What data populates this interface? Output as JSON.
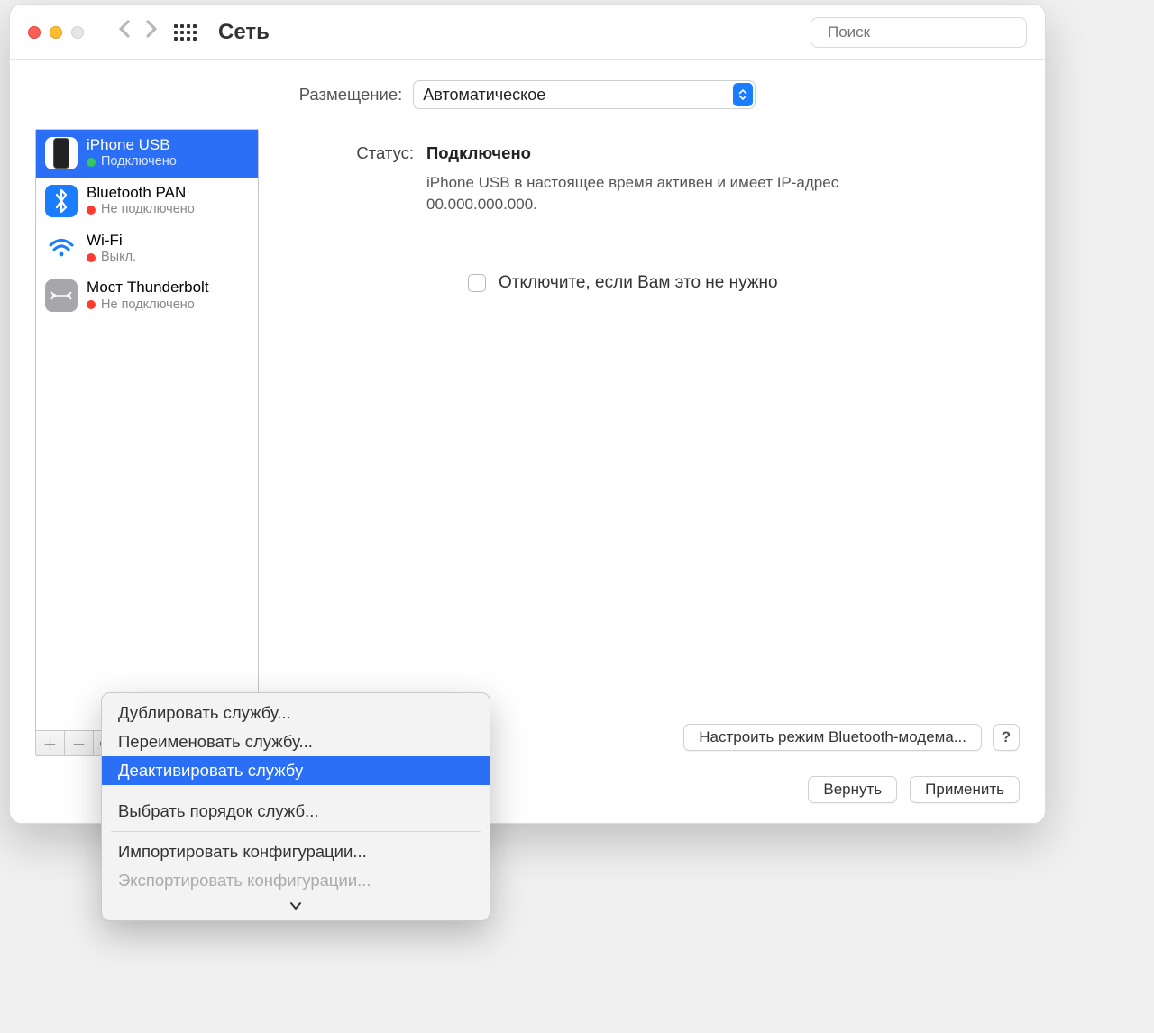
{
  "header": {
    "title": "Сеть",
    "search_placeholder": "Поиск"
  },
  "location": {
    "label": "Размещение:",
    "value": "Автоматическое"
  },
  "sidebar": {
    "services": [
      {
        "name": "iPhone USB",
        "status_text": "Подключено",
        "status_color": "green",
        "icon": "phone",
        "selected": true
      },
      {
        "name": "Bluetooth PAN",
        "status_text": "Не подключено",
        "status_color": "red",
        "icon": "bt",
        "selected": false
      },
      {
        "name": "Wi-Fi",
        "status_text": "Выкл.",
        "status_color": "red",
        "icon": "wifi",
        "selected": false
      },
      {
        "name": "Мост Thunderbolt",
        "status_text": "Не подключено",
        "status_color": "red",
        "icon": "tb",
        "selected": false
      }
    ]
  },
  "main": {
    "status_label": "Статус:",
    "status_value": "Подключено",
    "status_desc": "iPhone USB в настоящее время активен и имеет IP-адрес 00.000.000.000.",
    "checkbox_label": "Отключите, если Вам это не нужно",
    "configure_bt_label": "Настроить режим Bluetooth-модема...",
    "help_label": "?"
  },
  "footer": {
    "revert": "Вернуть",
    "apply": "Применить"
  },
  "context_menu": {
    "items": [
      {
        "label": "Дублировать службу...",
        "type": "item"
      },
      {
        "label": "Переименовать службу...",
        "type": "item"
      },
      {
        "label": "Деактивировать службу",
        "type": "highlight"
      },
      {
        "type": "sep"
      },
      {
        "label": "Выбрать порядок служб...",
        "type": "item"
      },
      {
        "type": "sep"
      },
      {
        "label": "Импортировать конфигурации...",
        "type": "item"
      },
      {
        "label": "Экспортировать конфигурации...",
        "type": "disabled"
      }
    ]
  }
}
